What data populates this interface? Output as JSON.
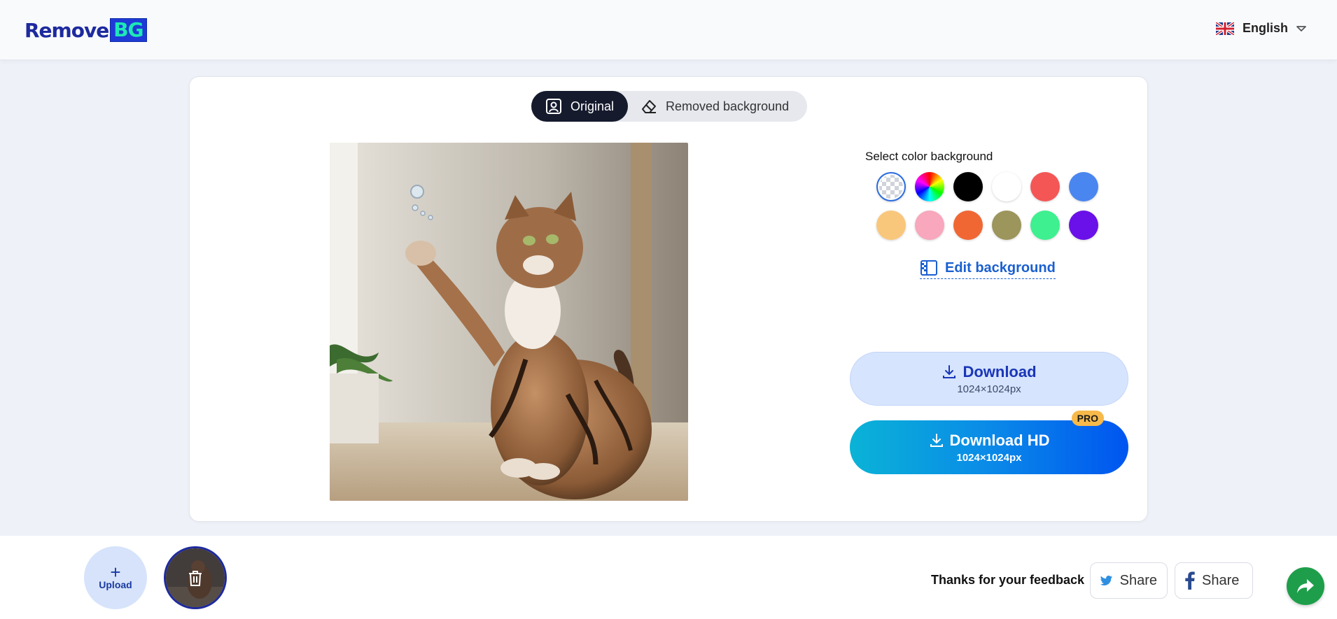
{
  "header": {
    "logo_text_remove": "Remove",
    "logo_text_bg": "BG",
    "language": "English",
    "language_icon": "uk-flag-icon"
  },
  "toggle": {
    "original_label": "Original",
    "removed_label": "Removed background",
    "active": "original"
  },
  "editor": {
    "select_color_title": "Select color background",
    "swatches": [
      {
        "name": "transparent",
        "selected": true
      },
      {
        "name": "rainbow"
      },
      {
        "name": "black",
        "color": "#000000"
      },
      {
        "name": "white",
        "color": "#ffffff"
      },
      {
        "name": "red",
        "color": "#f45656"
      },
      {
        "name": "blue",
        "color": "#4a86f0"
      },
      {
        "name": "peach",
        "color": "#f9c77c"
      },
      {
        "name": "pink",
        "color": "#f8a7bd"
      },
      {
        "name": "orange",
        "color": "#f06734"
      },
      {
        "name": "olive",
        "color": "#9c955c"
      },
      {
        "name": "mint",
        "color": "#3ef08f"
      },
      {
        "name": "purple",
        "color": "#6a10e8"
      }
    ],
    "edit_background_label": "Edit background"
  },
  "download": {
    "label": "Download",
    "size": "1024×1024px"
  },
  "download_hd": {
    "label": "Download HD",
    "size": "1024×1024px",
    "badge": "PRO"
  },
  "footer": {
    "upload_label": "Upload",
    "feedback_text": "Thanks for your feedback",
    "twitter_share": "Share",
    "facebook_share": "Share"
  }
}
